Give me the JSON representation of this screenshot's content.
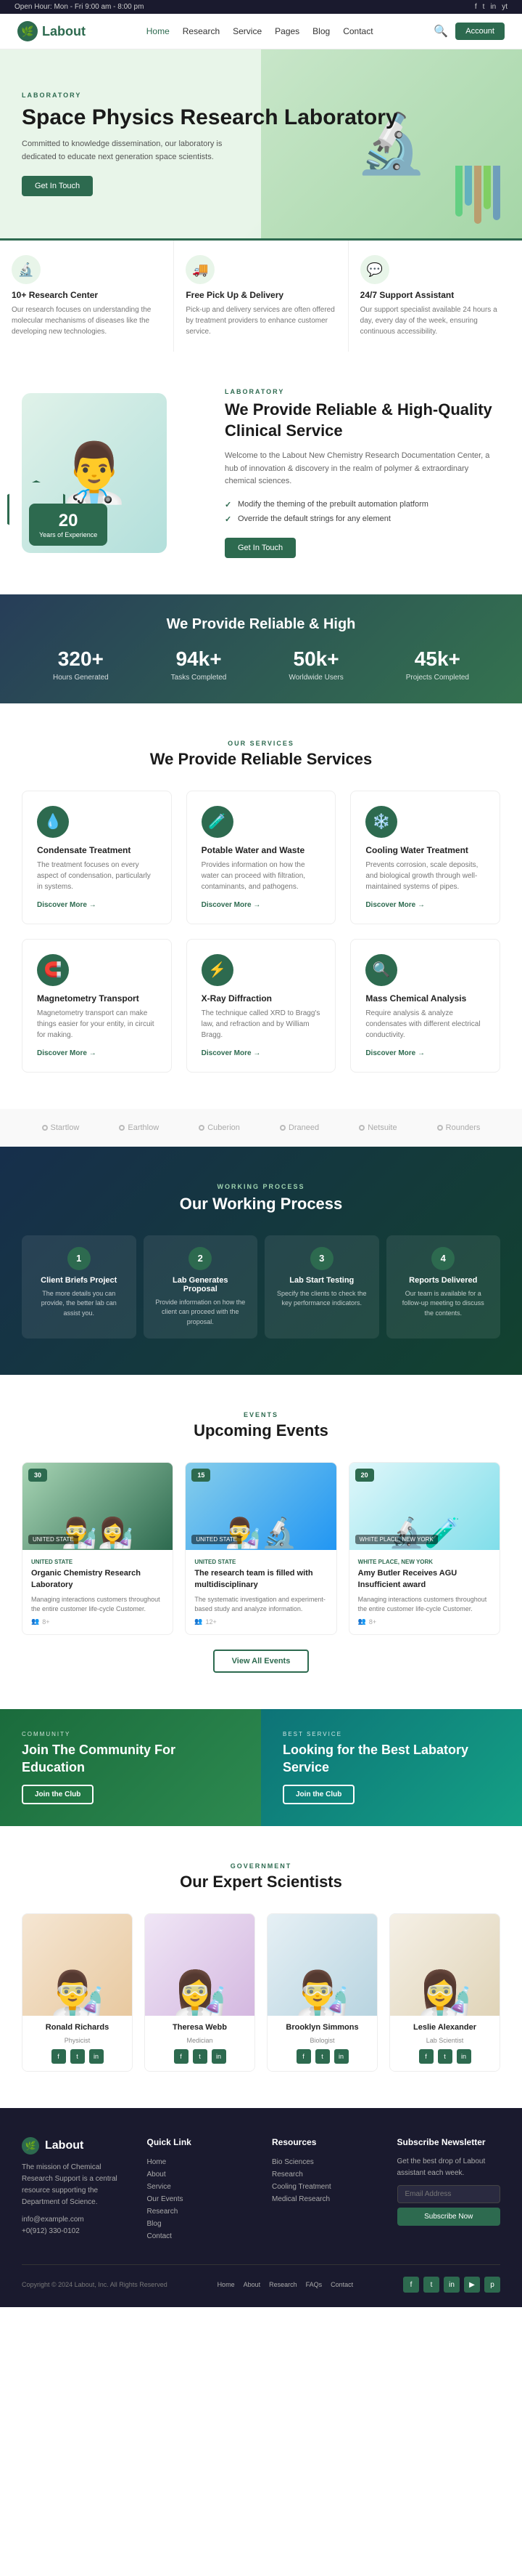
{
  "topbar": {
    "hours": "Open Hour: Mon - Fri 9:00 am - 8:00 pm",
    "social_icons": [
      "f",
      "t",
      "in",
      "yt"
    ]
  },
  "nav": {
    "logo_text": "Labout",
    "links": [
      {
        "label": "Home",
        "active": true
      },
      {
        "label": "Research",
        "active": false
      },
      {
        "label": "Service",
        "active": false
      },
      {
        "label": "Pages",
        "active": false
      },
      {
        "label": "Blog",
        "active": false
      },
      {
        "label": "Contact",
        "active": false
      }
    ],
    "account_btn": "Account"
  },
  "hero": {
    "label": "LABORATORY",
    "title": "Space Physics Research Laboratory",
    "description": "Committed to knowledge dissemination, our laboratory is dedicated to educate next generation space scientists.",
    "cta": "Get In Touch"
  },
  "features": [
    {
      "icon": "🔬",
      "title": "10+ Research Center",
      "description": "Our research focuses on understanding the molecular mechanisms of diseases like the developing new technologies."
    },
    {
      "icon": "🚚",
      "title": "Free Pick Up & Delivery",
      "description": "Pick-up and delivery services are often offered by treatment providers to enhance customer service."
    },
    {
      "icon": "💬",
      "title": "24/7 Support Assistant",
      "description": "Our support specialist available 24 hours a day, every day of the week, ensuring continuous accessibility."
    }
  ],
  "about": {
    "label": "LABORATORY",
    "title": "We Provide Reliable & High-Quality Clinical Service",
    "description": "Welcome to the Labout New Chemistry Research Documentation Center, a hub of innovation & discovery in the realm of polymer & extraordinary chemical sciences.",
    "checklist": [
      "Modify the theming of the prebuilt automation platform",
      "Override the default strings for any element"
    ],
    "cta": "Get In Touch",
    "years": "20",
    "years_label": "Years of Experience"
  },
  "stats": {
    "title": "We Provide Reliable & High",
    "items": [
      {
        "number": "320+",
        "label": "Hours Generated"
      },
      {
        "number": "94k+",
        "label": "Tasks Completed"
      },
      {
        "number": "50k+",
        "label": "Worldwide Users"
      },
      {
        "number": "45k+",
        "label": "Projects Completed"
      }
    ]
  },
  "services": {
    "label": "OUR SERVICES",
    "title": "We Provide Reliable Services",
    "items": [
      {
        "icon": "💧",
        "title": "Condensate Treatment",
        "description": "The treatment focuses on every aspect of condensation, particularly in systems.",
        "link": "Discover More →"
      },
      {
        "icon": "🧪",
        "title": "Potable Water and Waste",
        "description": "Provides information on how the water can proceed with filtration, contaminants, and pathogens.",
        "link": "Discover More →"
      },
      {
        "icon": "❄️",
        "title": "Cooling Water Treatment",
        "description": "Prevents corrosion, scale deposits, and biological growth through well-maintained systems of pipes.",
        "link": "Discover More →"
      },
      {
        "icon": "🧲",
        "title": "Magnetometry Transport",
        "description": "Magnetometry transport can make things easier for your entity, in circuit for making.",
        "link": "Discover More →"
      },
      {
        "icon": "⚡",
        "title": "X-Ray Diffraction",
        "description": "The technique called XRD to Bragg's law, and refraction and by William Bragg.",
        "link": "Discover More →"
      },
      {
        "icon": "🔍",
        "title": "Mass Chemical Analysis",
        "description": "Require analysis & analyze condensates with different electrical conductivity.",
        "link": "Discover More →"
      }
    ]
  },
  "partners": [
    "Startlow",
    "Earthlow",
    "Cuberion",
    "Draneed",
    "Netsuite",
    "Rounders"
  ],
  "process": {
    "label": "WORKING PROCESS",
    "title": "Our Working Process",
    "steps": [
      {
        "num": "1",
        "title": "Client Briefs Project",
        "description": "The more details you can provide, the better lab can assist you."
      },
      {
        "num": "2",
        "title": "Lab Generates Proposal",
        "description": "Provide information on how the client can proceed with the proposal."
      },
      {
        "num": "3",
        "title": "Lab Start Testing",
        "description": "Specify the clients to check the key performance indicators."
      },
      {
        "num": "4",
        "title": "Reports Delivered",
        "description": "Our team is available for a follow-up meeting to discuss the contents."
      }
    ]
  },
  "events": {
    "label": "EVENTS",
    "title": "Upcoming Events",
    "items": [
      {
        "date": "30",
        "location": "UNITED STATE",
        "tag": "UNITED STATE",
        "img_class": "event-img-green",
        "title": "Organic Chemistry Research Laboratory",
        "description": "Managing interactions customers throughout the entire customer life-cycle Customer.",
        "attendees": "8+"
      },
      {
        "date": "15",
        "location": "UNITED STATE",
        "tag": "UNITED STATE",
        "img_class": "event-img-blue",
        "title": "The research team is filled with multidisciplinary",
        "description": "The systematic investigation and experiment-based study and analyze information.",
        "attendees": "12+"
      },
      {
        "date": "20",
        "location": "WHITE PLACE, NEW YORK",
        "tag": "WHITE PLACE, NEW YORK",
        "img_class": "event-img-light",
        "title": "Amy Butler Receives AGU Insufficient award",
        "description": "Managing interactions customers throughout the entire customer life-cycle Customer.",
        "attendees": "8+"
      }
    ],
    "view_all": "View All Events"
  },
  "community": [
    {
      "label": "COMMUNITY",
      "title": "Join The Community For Education",
      "cta": "Join the Club",
      "bg_class": "banner-green"
    },
    {
      "label": "BEST SERVICE",
      "title": "Looking for the Best Labatory Service",
      "cta": "Join the Club",
      "bg_class": "banner-teal"
    }
  ],
  "scientists": {
    "label": "GOVERNMENT",
    "title": "Our Expert Scientists",
    "items": [
      {
        "name": "Ronald Richards",
        "role": "Physicist",
        "photo_class": "photo-male1",
        "emoji": "👨‍🔬"
      },
      {
        "name": "Theresa Webb",
        "role": "Medician",
        "photo_class": "photo-female1",
        "emoji": "👩‍🔬"
      },
      {
        "name": "Brooklyn Simmons",
        "role": "Biologist",
        "photo_class": "photo-male2",
        "emoji": "👨‍🔬"
      },
      {
        "name": "Leslie Alexander",
        "role": "Lab Scientist",
        "photo_class": "photo-female2",
        "emoji": "👩‍🔬"
      }
    ]
  },
  "footer": {
    "logo": "Labout",
    "about_text": "The mission of Chemical Research Support is a central resource supporting the Department of Science.",
    "email": "info@example.com",
    "phone": "+0(912) 330-0102",
    "quick_links": {
      "title": "Quick Link",
      "items": [
        "Home",
        "About",
        "Service",
        "Our Events",
        "Research",
        "Blog",
        "Contact"
      ]
    },
    "resources": {
      "title": "Resources",
      "items": [
        "Bio Sciences",
        "Research",
        "Cooling Treatment",
        "Medical Research"
      ]
    },
    "newsletter": {
      "title": "Subscribe Newsletter",
      "description": "Get the best drop of Labout assistant each week.",
      "placeholder": "Email Address",
      "btn": "Subscribe Now"
    },
    "nav_links": [
      "Home",
      "About",
      "Research",
      "FAQs",
      "Contact"
    ],
    "copyright": "Copyright © 2024 Labout, Inc. All Rights Reserved",
    "social_icons": [
      "f",
      "t",
      "in",
      "yt",
      "p"
    ]
  }
}
